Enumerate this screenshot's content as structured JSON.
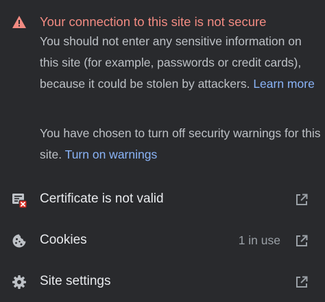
{
  "header": {
    "icon": "warning-triangle-icon",
    "title": "Your connection to this site is not secure",
    "title_color": "#f28b82"
  },
  "description": {
    "text": "You should not enter any sensitive information on this site (for example, passwords or credit cards), because it could be stolen by attackers.",
    "learn_more": "Learn more"
  },
  "warnings": {
    "text": "You have chosen to turn off security warnings for this site.",
    "turn_on": "Turn on warnings"
  },
  "rows": [
    {
      "label": "Certificate is not valid",
      "icon": "certificate-error-icon",
      "meta": "",
      "action_icon": "open-external-icon"
    },
    {
      "label": "Cookies",
      "icon": "cookie-icon",
      "meta": "1 in use",
      "action_icon": "open-external-icon"
    },
    {
      "label": "Site settings",
      "icon": "gear-icon",
      "meta": "",
      "action_icon": "open-external-icon"
    }
  ],
  "colors": {
    "background": "#292a2d",
    "link": "#8ab4f8",
    "error": "#f28b82",
    "text_primary": "#e8eaed",
    "text_secondary": "#bdc1c6"
  }
}
